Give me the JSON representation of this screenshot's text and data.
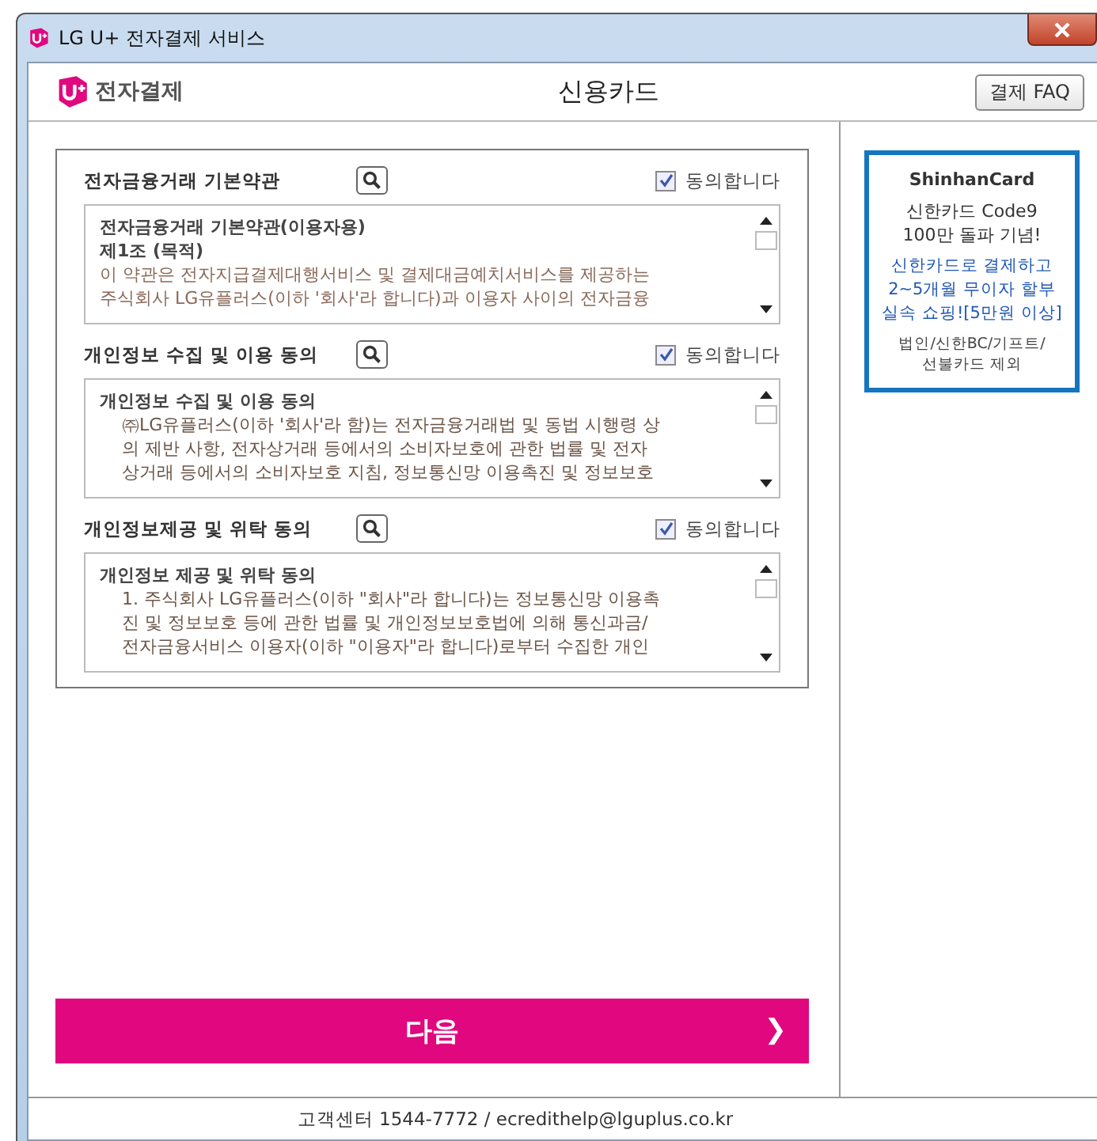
{
  "window": {
    "title": "LG U+ 전자결제 서비스"
  },
  "header": {
    "logo_text": "전자결제",
    "title": "신용카드",
    "faq_button": "결제 FAQ"
  },
  "terms": [
    {
      "title": "전자금융거래 기본약관",
      "agree_label": "동의합니다",
      "checked": true,
      "lines": [
        {
          "kind": "heading",
          "text": "전자금융거래 기본약관(이용자용)"
        },
        {
          "kind": "heading",
          "text": "제1조 (목적)"
        },
        {
          "kind": "body",
          "text": "이 약관은 전자지급결제대행서비스 및 결제대금예치서비스를 제공하는"
        },
        {
          "kind": "body",
          "text": "주식회사 LG유플러스(이하 '회사'라 합니다)과 이용자 사이의 전자금융"
        }
      ]
    },
    {
      "title": "개인정보 수집 및 이용 동의",
      "agree_label": "동의합니다",
      "checked": true,
      "lines": [
        {
          "kind": "heading",
          "text": "개인정보 수집 및 이용 동의"
        },
        {
          "kind": "indent",
          "text": "㈜LG유플러스(이하 '회사'라 함)는 전자금융거래법 및 동법 시행령 상"
        },
        {
          "kind": "indent",
          "text": "의 제반 사항, 전자상거래 등에서의 소비자보호에 관한 법률 및 전자"
        },
        {
          "kind": "indent",
          "text": "상거래 등에서의 소비자보호 지침, 정보통신망 이용촉진 및 정보보호"
        }
      ]
    },
    {
      "title": "개인정보제공 및 위탁 동의",
      "agree_label": "동의합니다",
      "checked": true,
      "lines": [
        {
          "kind": "heading",
          "text": "개인정보 제공 및 위탁 동의"
        },
        {
          "kind": "indent",
          "text": "1. 주식회사 LG유플러스(이하 \"회사\"라 합니다)는 정보통신망 이용촉"
        },
        {
          "kind": "indent",
          "text": "진 및 정보보호 등에 관한 법률 및 개인정보보호법에 의해 통신과금/"
        },
        {
          "kind": "indent",
          "text": "전자금융서비스 이용자(이하 \"이용자\"라 합니다)로부터 수집한 개인"
        }
      ]
    }
  ],
  "next_button": {
    "label": "다음",
    "arrow": "❯"
  },
  "ad": {
    "brand": "ShinhanCard",
    "lines": [
      {
        "kind": "title",
        "text": "신한카드 Code9"
      },
      {
        "kind": "title",
        "text": "100만 돌파 기념!"
      },
      {
        "kind": "highlight",
        "text": "신한카드로 결제하고"
      },
      {
        "kind": "highlight",
        "text": "2~5개월 무이자 할부"
      },
      {
        "kind": "highlight",
        "text": "실속 쇼핑![5만원 이상]"
      },
      {
        "kind": "note",
        "text": "법인/신한BC/기프트/"
      },
      {
        "kind": "note",
        "text": "선불카드 제외"
      }
    ]
  },
  "footer": {
    "text": "고객센터 1544-7772 / ecredithelp@lguplus.co.kr"
  }
}
